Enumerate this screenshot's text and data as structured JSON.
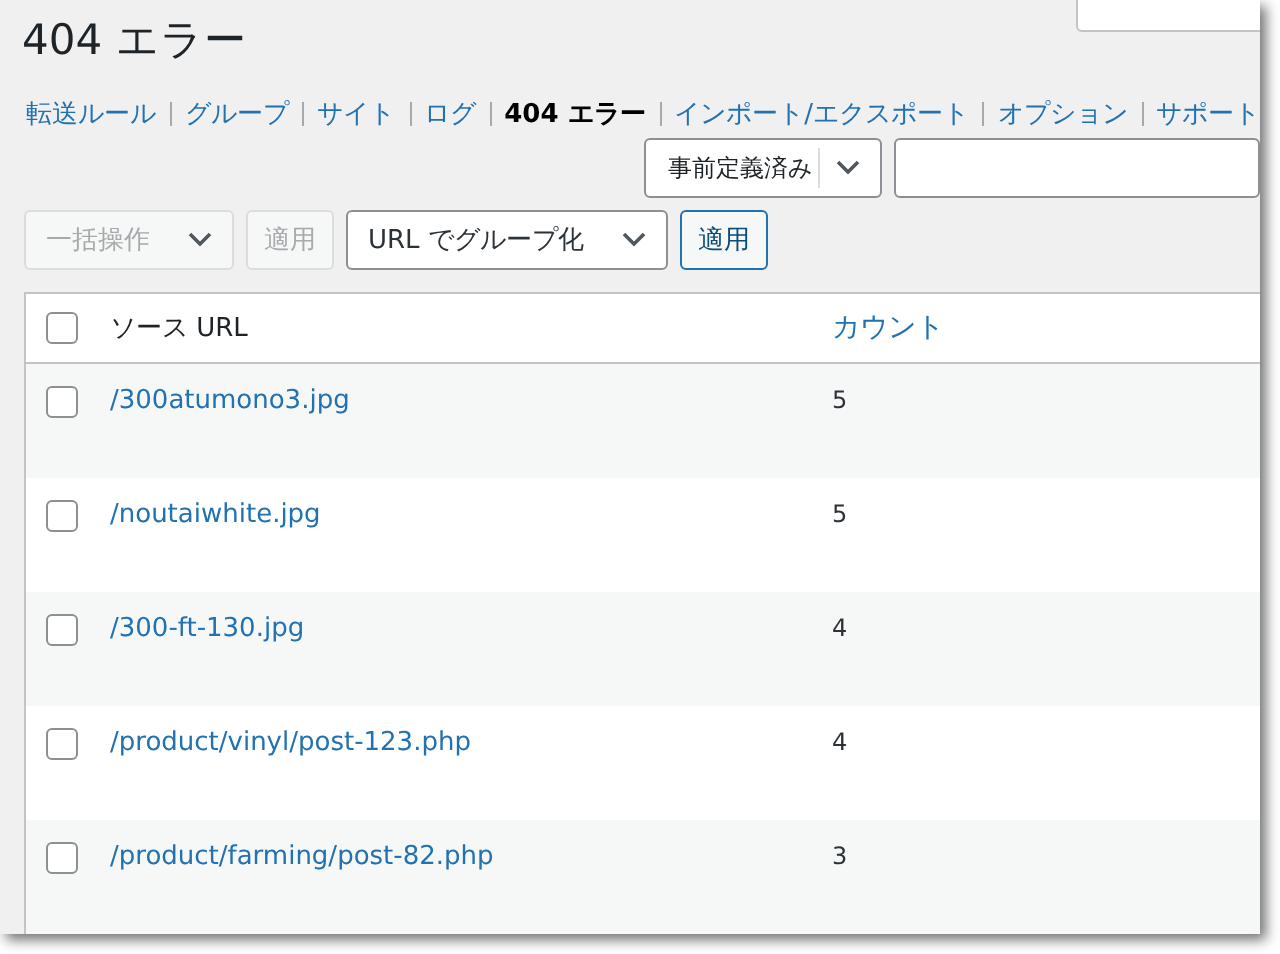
{
  "title": "404 エラー",
  "nav": [
    {
      "label": "転送ルール",
      "selected": false
    },
    {
      "label": "グループ",
      "selected": false
    },
    {
      "label": "サイト",
      "selected": false
    },
    {
      "label": "ログ",
      "selected": false
    },
    {
      "label": "404 エラー",
      "selected": true
    },
    {
      "label": "インポート/エクスポート",
      "selected": false
    },
    {
      "label": "オプション",
      "selected": false
    },
    {
      "label": "サポート",
      "selected": false
    }
  ],
  "filter": {
    "select": "事前定義済み"
  },
  "bulk": {
    "select": "一括操作",
    "apply": "適用",
    "disabled": true
  },
  "group": {
    "select": "URL でグループ化",
    "apply": "適用",
    "disabled": false
  },
  "table": {
    "all_checked": false,
    "columns": [
      "ソース URL",
      "カウント"
    ],
    "rows": [
      {
        "url": "/300atumono3.jpg",
        "count": "5",
        "checked": false
      },
      {
        "url": "/noutaiwhite.jpg",
        "count": "5",
        "checked": false
      },
      {
        "url": "/300-ft-130.jpg",
        "count": "4",
        "checked": false
      },
      {
        "url": "/product/vinyl/post-123.php",
        "count": "4",
        "checked": false
      },
      {
        "url": "/product/farming/post-82.php",
        "count": "3",
        "checked": false
      }
    ]
  }
}
